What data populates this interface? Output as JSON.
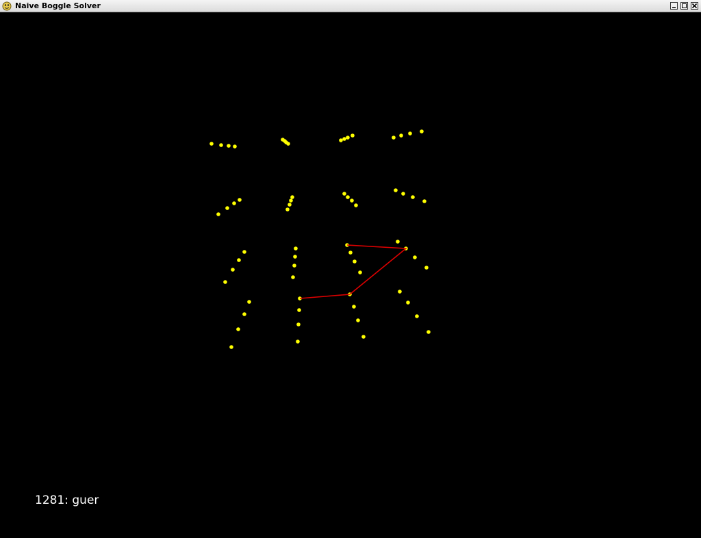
{
  "window": {
    "title": "Naive Boggle Solver"
  },
  "icons": {
    "app": "pygame-snake-icon",
    "minimize": "minimize-icon",
    "maximize": "maximize-icon",
    "close": "close-icon"
  },
  "colors": {
    "background": "#000000",
    "dot": "#ffff00",
    "path": "#dd0000",
    "text": "#ffffff"
  },
  "status": {
    "text": "1281: guer"
  }
}
